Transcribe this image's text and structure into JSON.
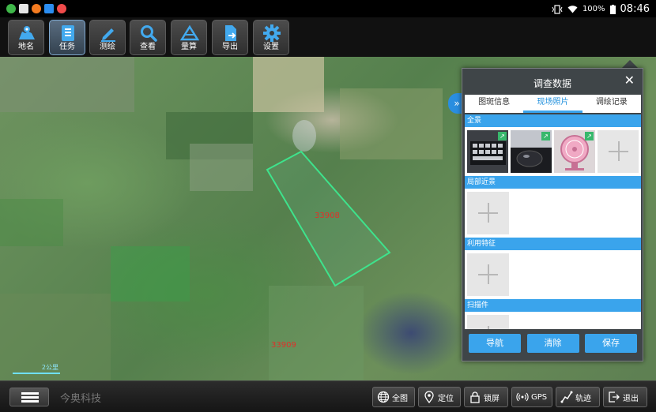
{
  "statusbar": {
    "battery": "100%",
    "time": "08:46",
    "notification_colors": [
      "#3fb649",
      "#e4e4e4",
      "#f47b20",
      "#2b8df0",
      "#f04b4b"
    ]
  },
  "toolbar": {
    "buttons": [
      {
        "label": "地名",
        "icon": "map-location-icon"
      },
      {
        "label": "任务",
        "icon": "task-list-icon"
      },
      {
        "label": "测绘",
        "icon": "pencil-icon"
      },
      {
        "label": "查看",
        "icon": "search-icon"
      },
      {
        "label": "量算",
        "icon": "measure-icon"
      },
      {
        "label": "导出",
        "icon": "export-icon"
      },
      {
        "label": "设置",
        "icon": "gear-icon"
      }
    ],
    "active_index": 1
  },
  "map": {
    "parcels": [
      {
        "label": "33908"
      },
      {
        "label": "33909"
      }
    ],
    "scale_label": "2公里",
    "parcel_outline_color": "#3ee38c"
  },
  "panel": {
    "title": "调查数据",
    "close_glyph": "✕",
    "collapse_glyph": "»",
    "tabs": [
      "图斑信息",
      "现场照片",
      "调绘记录"
    ],
    "active_tab": 1,
    "sections": [
      {
        "title": "全景",
        "photos": [
          "keyboard-photo",
          "mouse-photo",
          "fan-photo"
        ]
      },
      {
        "title": "局部近景",
        "photos": []
      },
      {
        "title": "利用特征",
        "photos": []
      },
      {
        "title": "扫描件",
        "photos": []
      }
    ],
    "actions": [
      "导航",
      "清除",
      "保存"
    ]
  },
  "bottombar": {
    "company": "今奥科技",
    "buttons": [
      {
        "label": "全图",
        "icon": "globe-icon"
      },
      {
        "label": "定位",
        "icon": "location-pin-icon"
      },
      {
        "label": "锁屏",
        "icon": "lock-icon"
      },
      {
        "label": "GPS",
        "icon": "gps-signal-icon"
      },
      {
        "label": "轨迹",
        "icon": "track-icon"
      },
      {
        "label": "退出",
        "icon": "exit-icon"
      }
    ]
  },
  "colors": {
    "accent": "#3aa4ec",
    "parcel_label": "#e0302a"
  }
}
